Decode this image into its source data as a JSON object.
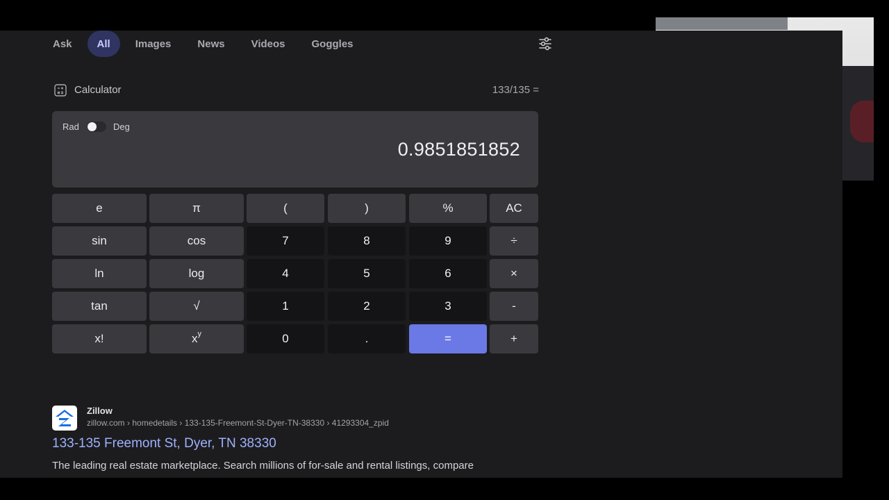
{
  "tabs": [
    {
      "label": "Ask"
    },
    {
      "label": "All"
    },
    {
      "label": "Images"
    },
    {
      "label": "News"
    },
    {
      "label": "Videos"
    },
    {
      "label": "Goggles"
    }
  ],
  "active_tab": "All",
  "filter_icon": "sliders-icon",
  "calculator": {
    "title": "Calculator",
    "expression": "133/135 =",
    "mode_rad": "Rad",
    "mode_deg": "Deg",
    "result": "0.9851851852",
    "keys": {
      "e": "e",
      "pi": "π",
      "lparen": "(",
      "rparen": ")",
      "percent": "%",
      "ac": "AC",
      "sin": "sin",
      "cos": "cos",
      "seven": "7",
      "eight": "8",
      "nine": "9",
      "divide": "÷",
      "ln": "ln",
      "log": "log",
      "four": "4",
      "five": "5",
      "six": "6",
      "multiply": "×",
      "tan": "tan",
      "sqrt": "√",
      "one": "1",
      "two": "2",
      "three": "3",
      "minus": "-",
      "factorial": "x!",
      "pow_base": "x",
      "pow_exp": "y",
      "zero": "0",
      "dot": ".",
      "equals": "=",
      "plus": "+"
    }
  },
  "search_result": {
    "site_name": "Zillow",
    "url": "zillow.com › homedetails › 133-135-Freemont-St-Dyer-TN-38330 › 41293304_zpid",
    "title": "133-135 Freemont St, Dyer, TN 38330",
    "snippet": "The leading real estate marketplace. Search millions of for-sale and rental listings, compare"
  },
  "colors": {
    "accent": "#6b79e6",
    "link": "#9fb0ff",
    "active_tab_bg": "#2f3461",
    "page_bg": "#1c1c1e"
  }
}
